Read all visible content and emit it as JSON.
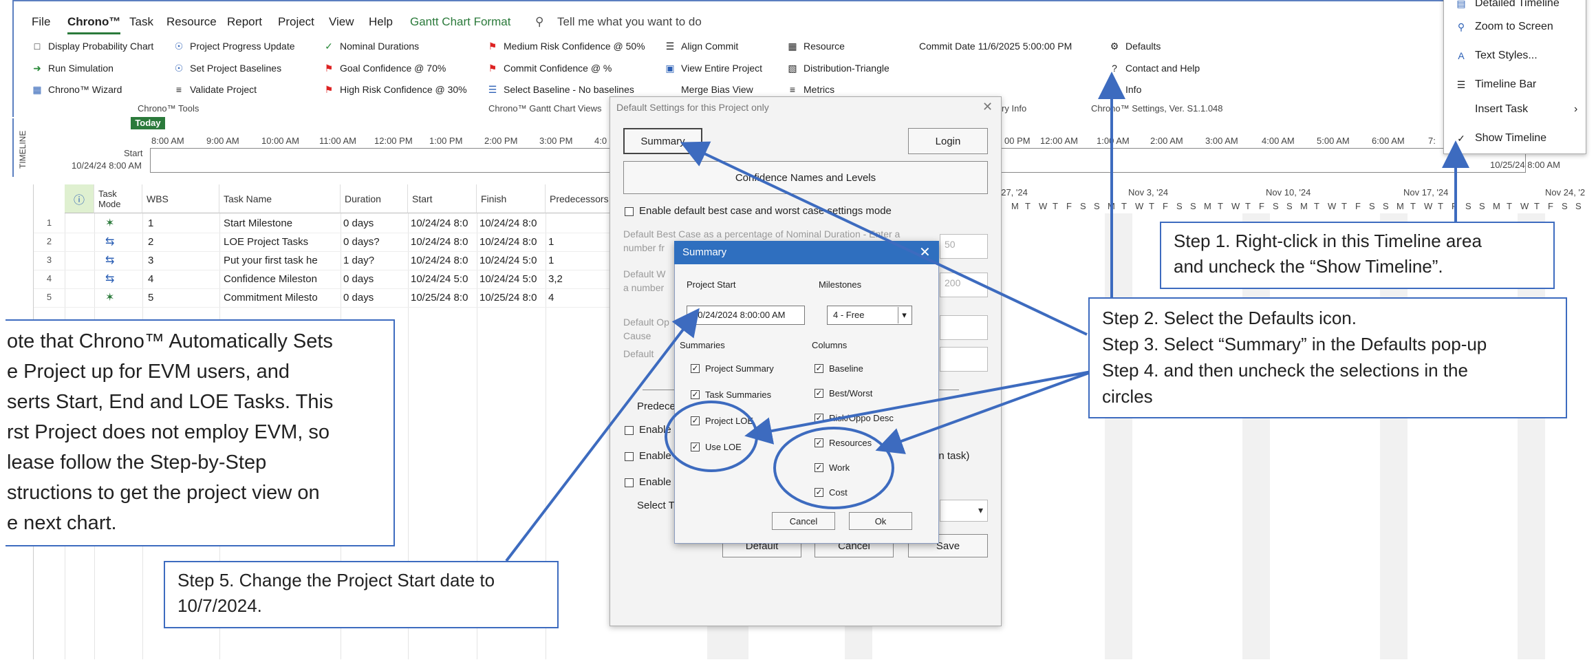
{
  "menu": {
    "items": [
      "File",
      "Chrono™",
      "Task",
      "Resource",
      "Report",
      "Project",
      "View",
      "Help",
      "Gantt Chart Format"
    ],
    "tell_me": "Tell me what you want to do"
  },
  "ribbon": {
    "tools": [
      "Display Probability Chart",
      "Run Simulation",
      "Chrono™ Wizard"
    ],
    "tools2": [
      "Project Progress Update",
      "Set Project Baselines",
      "Validate Project"
    ],
    "tools_label": "Chrono™ Tools",
    "views1": [
      "Nominal Durations",
      "Goal Confidence @ 70%",
      "High Risk Confidence @ 30%"
    ],
    "views2": [
      "Medium Risk Confidence @ 50%",
      "Commit Confidence @ %",
      "Select Baseline - No baselines"
    ],
    "views3": [
      "Align Commit",
      "View Entire Project",
      "Merge Bias View"
    ],
    "views_label": "Chrono™ Gantt Chart Views",
    "resource": [
      "Resource",
      "Distribution-Triangle",
      "Metrics"
    ],
    "commit_date": "Commit Date 11/6/2025 5:00:00 PM",
    "summary_info_label": "mary Info",
    "settings": [
      "Defaults",
      "Contact and Help",
      "Info"
    ],
    "settings_label": "Chrono™ Settings, Ver. S1.1.048"
  },
  "timeline": {
    "label": "TIMELINE",
    "today": "Today",
    "start_label": "Start",
    "start_date": "10/24/24 8:00 AM",
    "end_date": "10/25/24 8:00 AM",
    "ticks_left": [
      "8:00 AM",
      "9:00 AM",
      "10:00 AM",
      "11:00 AM",
      "12:00 PM",
      "1:00 PM",
      "2:00 PM",
      "3:00 PM",
      "4:0"
    ],
    "ticks_right": [
      "00 PM",
      "12:00 AM",
      "1:00 AM",
      "2:00 AM",
      "3:00 AM",
      "4:00 AM",
      "5:00 AM",
      "6:00 AM",
      "7:"
    ]
  },
  "grid": {
    "headers": [
      "Task Mode",
      "WBS",
      "Task Name",
      "Duration",
      "Start",
      "Finish",
      "Predecessors"
    ],
    "rows": [
      {
        "id": "1",
        "wbs": "1",
        "name": "Start Milestone",
        "duration": "0 days",
        "start": "10/24/24 8:0",
        "finish": "10/24/24 8:0",
        "pred": ""
      },
      {
        "id": "2",
        "wbs": "2",
        "name": "LOE Project Tasks",
        "duration": "0 days?",
        "start": "10/24/24 8:0",
        "finish": "10/24/24 8:0",
        "pred": "1"
      },
      {
        "id": "3",
        "wbs": "3",
        "name": "Put your first task he",
        "duration": "1 day?",
        "start": "10/24/24 8:0",
        "finish": "10/24/24 5:0",
        "pred": "1"
      },
      {
        "id": "4",
        "wbs": "4",
        "name": "Confidence Mileston",
        "duration": "0 days",
        "start": "10/24/24 5:0",
        "finish": "10/24/24 5:0",
        "pred": "3,2"
      },
      {
        "id": "5",
        "wbs": "5",
        "name": "Commitment Milesto",
        "duration": "0 days",
        "start": "10/25/24 8:0",
        "finish": "10/25/24 8:0",
        "pred": "4"
      }
    ]
  },
  "gantt": {
    "weeks": [
      "t 27, '24",
      "Nov 3, '24",
      "Nov 10, '24",
      "Nov 17, '24",
      "Nov 24, '2"
    ],
    "days": [
      "M",
      "T",
      "W",
      "T",
      "F",
      "S",
      "S"
    ]
  },
  "defaults_dialog": {
    "title": "Default Settings for this Project only",
    "summary_btn": "Summary",
    "login_btn": "Login",
    "confidence_btn": "Confidence Names and Levels",
    "enable_best_worst": "Enable default best case and worst case settings mode",
    "best_case_text_1": "Default Best Case as a percentage of Nominal Duration - Enter a",
    "best_case_text_2": "number fr",
    "best_value": "50",
    "worst_text_1": "Default W",
    "worst_text_2": "a number",
    "worst_value": "200",
    "opp_text_1": "Default Op",
    "opp_text_2": "Cause",
    "def_text": "Default",
    "predece": "Predece",
    "enable1": "Enable",
    "enable2": "Enable",
    "enable3": "Enable",
    "an_task": "an task)",
    "select_t": "Select T",
    "default_btn": "Default",
    "cancel_btn": "Cancel",
    "save_btn": "Save"
  },
  "summary_dialog": {
    "title": "Summary",
    "project_start_label": "Project Start",
    "project_start_value": "10/24/2024 8:00:00 AM",
    "milestones_label": "Milestones",
    "milestones_value": "4 - Free",
    "summaries_label": "Summaries",
    "columns_label": "Columns",
    "summaries": [
      "Project Summary",
      "Task Summaries",
      "Project LOE",
      "Use LOE"
    ],
    "columns": [
      "Baseline",
      "Best/Worst",
      "Risk/Oppo Desc",
      "Resources",
      "Work",
      "Cost"
    ],
    "cancel": "Cancel",
    "ok": "Ok"
  },
  "context_menu": {
    "items": [
      "Detailed Timeline",
      "Zoom to Screen",
      "Text Styles...",
      "Timeline Bar",
      "Insert Task",
      "Show Timeline"
    ]
  },
  "callouts": {
    "step1_l1": "Step 1. Right-click in this Timeline area",
    "step1_l2": "and uncheck the “Show Timeline”.",
    "step2": "Step 2. Select the Defaults icon.",
    "step3": "Step 3. Select “Summary” in the Defaults pop-up",
    "step4_l1": "Step 4.  and then uncheck the selections in the",
    "step4_l2": "circles",
    "step5_l1": "Step 5. Change the Project Start date to",
    "step5_l2": "10/7/2024.",
    "note": [
      "ote that Chrono™ Automatically Sets",
      "e Project up for EVM users, and",
      "serts Start, End and LOE Tasks.  This",
      "rst Project does not employ EVM, so",
      "lease follow the Step-by-Step",
      "structions to get the project view on",
      "e next chart."
    ]
  },
  "colors": {
    "accent": "#3d6bbf",
    "green": "#2b7a3b",
    "title_blue": "#2f6fbf"
  }
}
